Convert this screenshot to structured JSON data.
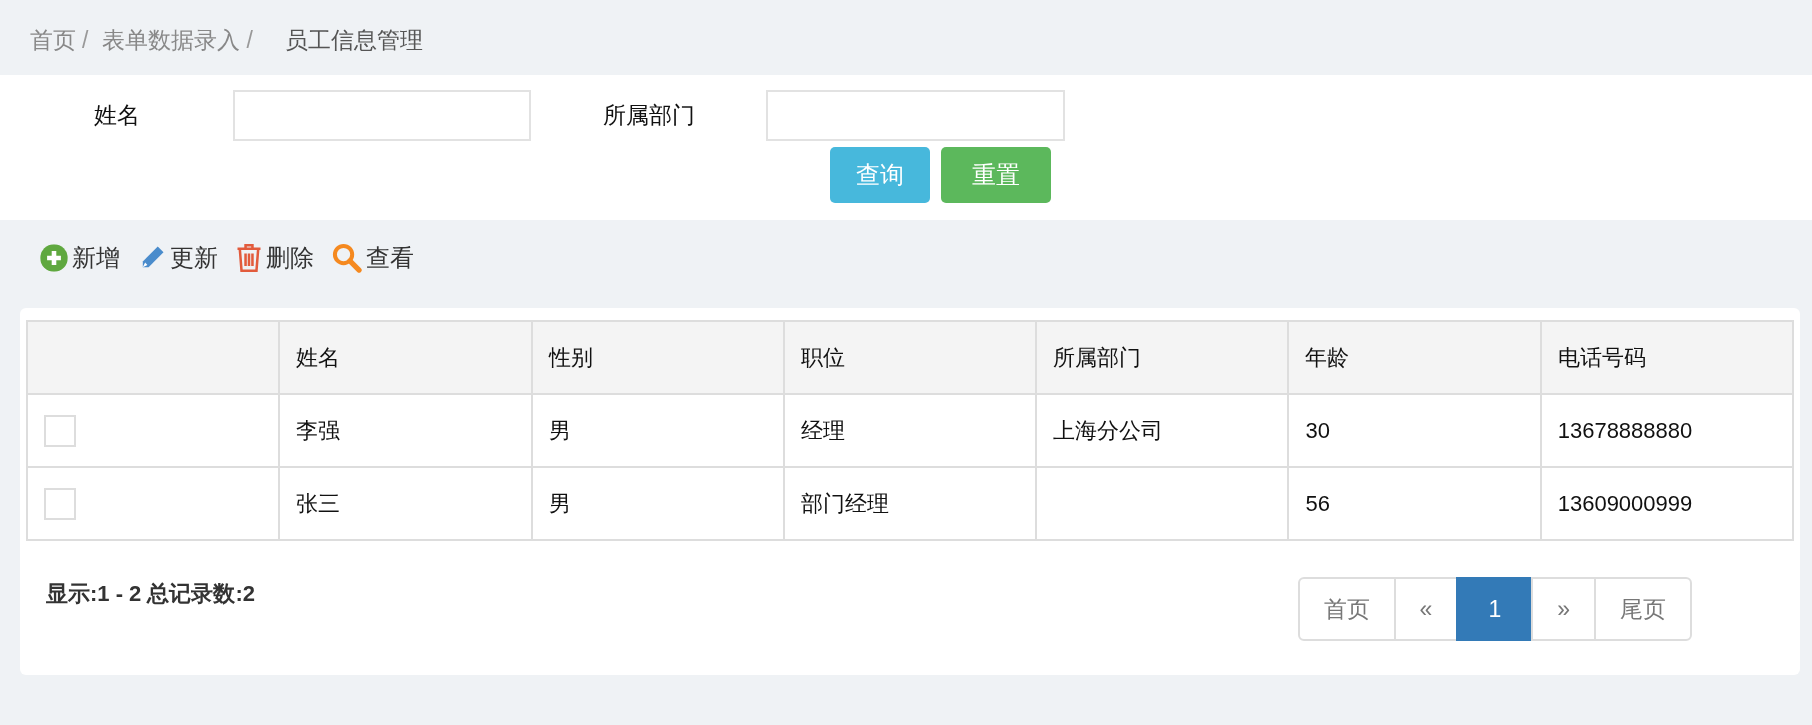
{
  "breadcrumb": [
    {
      "label": "首页",
      "current": false,
      "separator": "/"
    },
    {
      "label": "表单数据录入",
      "current": false,
      "separator": "/"
    },
    {
      "label": "员工信息管理",
      "current": true
    }
  ],
  "search_form": {
    "fields": [
      {
        "label": "姓名"
      },
      {
        "label": "所属部门"
      }
    ],
    "buttons": [
      {
        "label": "查询",
        "kind": "primary"
      },
      {
        "label": "重置",
        "kind": "reset"
      }
    ]
  },
  "toolbar": [
    {
      "label": "新增",
      "kind": "add"
    },
    {
      "label": "更新",
      "kind": "edit"
    },
    {
      "label": "删除",
      "kind": "delete"
    },
    {
      "label": "查看",
      "kind": "view"
    }
  ],
  "table": {
    "columns": [
      "姓名",
      "性别",
      "职位",
      "所属部门",
      "年龄",
      "电话号码"
    ],
    "rows": [
      {
        "checked": false,
        "cells": [
          "李强",
          "男",
          "经理",
          "上海分公司",
          "30",
          "13678888880"
        ]
      },
      {
        "checked": false,
        "cells": [
          "张三",
          "男",
          "部门经理",
          null,
          "56",
          "13609000999"
        ]
      }
    ]
  },
  "summary": "显示:1 - 2 总记录数:2",
  "pagination": [
    {
      "label": "首页",
      "selected": false
    },
    {
      "label": "«",
      "selected": false
    },
    {
      "label": "1",
      "selected": true
    },
    {
      "label": "»",
      "selected": false
    },
    {
      "label": "尾页",
      "selected": false
    }
  ]
}
